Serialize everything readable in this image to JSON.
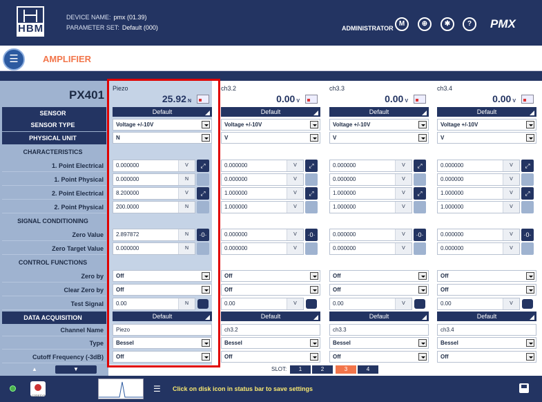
{
  "header": {
    "logo_text": "HBM",
    "device_label": "DEVICE NAME:",
    "device_value": "pmx (01.39)",
    "param_label": "PARAMETER SET:",
    "param_value": "Default (000)",
    "user": "ADMINISTRATOR",
    "brand": "PMX",
    "icons": [
      "hbm-icon",
      "globe-icon",
      "settings-icon",
      "help-icon"
    ],
    "help_glyph": "?"
  },
  "page": {
    "title": "AMPLIFIER",
    "module": "PX401"
  },
  "labels": {
    "sensor": "SENSOR",
    "sensor_type": "SENSOR TYPE",
    "physical_unit": "PHYSICAL UNIT",
    "characteristics": "CHARACTERISTICS",
    "p1_el": "1. Point Electrical",
    "p1_ph": "1. Point Physical",
    "p2_el": "2. Point Electrical",
    "p2_ph": "2. Point Physical",
    "signal_cond": "SIGNAL CONDITIONING",
    "zero_value": "Zero Value",
    "zero_target": "Zero Target Value",
    "control_functions": "CONTROL FUNCTIONS",
    "zero_by": "Zero by",
    "clear_zero_by": "Clear Zero by",
    "test_signal": "Test Signal",
    "data_acq": "DATA ACQUISITION",
    "channel_name": "Channel Name",
    "type": "Type",
    "cutoff": "Cutoff Frequency (-3dB)"
  },
  "channels": [
    {
      "name": "Piezo",
      "value": "25.92",
      "unit": "N",
      "sensor": "Default",
      "sensor_type": "Voltage +/-10V",
      "physical_unit": "N",
      "p1_el": "0.000000",
      "p1_el_u": "V",
      "p1_ph": "0.000000",
      "p1_ph_u": "N",
      "p2_el": "8.200000",
      "p2_el_u": "V",
      "p2_ph": "200.0000",
      "p2_ph_u": "N",
      "zero": "2.897872",
      "zero_u": "N",
      "zero_target": "0.000000",
      "zero_target_u": "N",
      "zero_by": "Off",
      "clear_zero_by": "Off",
      "test_signal": "0.00",
      "test_u": "N",
      "daq": "Default",
      "chname": "Piezo",
      "type": "Bessel",
      "cutoff": "Off"
    },
    {
      "name": "ch3.2",
      "value": "0.00",
      "unit": "V",
      "sensor": "Default",
      "sensor_type": "Voltage +/-10V",
      "physical_unit": "V",
      "p1_el": "0.000000",
      "p1_el_u": "V",
      "p1_ph": "0.000000",
      "p1_ph_u": "V",
      "p2_el": "1.000000",
      "p2_el_u": "V",
      "p2_ph": "1.000000",
      "p2_ph_u": "V",
      "zero": "0.000000",
      "zero_u": "V",
      "zero_target": "0.000000",
      "zero_target_u": "V",
      "zero_by": "Off",
      "clear_zero_by": "Off",
      "test_signal": "0.00",
      "test_u": "V",
      "daq": "Default",
      "chname": "ch3.2",
      "type": "Bessel",
      "cutoff": "Off"
    },
    {
      "name": "ch3.3",
      "value": "0.00",
      "unit": "V",
      "sensor": "Default",
      "sensor_type": "Voltage +/-10V",
      "physical_unit": "V",
      "p1_el": "0.000000",
      "p1_el_u": "V",
      "p1_ph": "0.000000",
      "p1_ph_u": "V",
      "p2_el": "1.000000",
      "p2_el_u": "V",
      "p2_ph": "1.000000",
      "p2_ph_u": "V",
      "zero": "0.000000",
      "zero_u": "V",
      "zero_target": "0.000000",
      "zero_target_u": "V",
      "zero_by": "Off",
      "clear_zero_by": "Off",
      "test_signal": "0.00",
      "test_u": "V",
      "daq": "Default",
      "chname": "ch3.3",
      "type": "Bessel",
      "cutoff": "Off"
    },
    {
      "name": "ch3.4",
      "value": "0.00",
      "unit": "V",
      "sensor": "Default",
      "sensor_type": "Voltage +/-10V",
      "physical_unit": "V",
      "p1_el": "0.000000",
      "p1_el_u": "V",
      "p1_ph": "0.000000",
      "p1_ph_u": "V",
      "p2_el": "1.000000",
      "p2_el_u": "V",
      "p2_ph": "1.000000",
      "p2_ph_u": "V",
      "zero": "0.000000",
      "zero_u": "V",
      "zero_target": "0.000000",
      "zero_target_u": "V",
      "zero_by": "Off",
      "clear_zero_by": "Off",
      "test_signal": "0.00",
      "test_u": "V",
      "daq": "Default",
      "chname": "ch3.4",
      "type": "Bessel",
      "cutoff": "Off"
    }
  ],
  "slots": {
    "label": "SLOT:",
    "items": [
      "1",
      "2",
      "3",
      "4"
    ],
    "active": "3"
  },
  "footer": {
    "status": "Click on disk icon in status bar to save settings",
    "codesys": "CODESYS"
  },
  "colors": {
    "navy": "#233462",
    "accent": "#f2754a",
    "selected_column": "#c5d3e6",
    "highlight": "#e00000",
    "status_text": "#f8e870"
  }
}
